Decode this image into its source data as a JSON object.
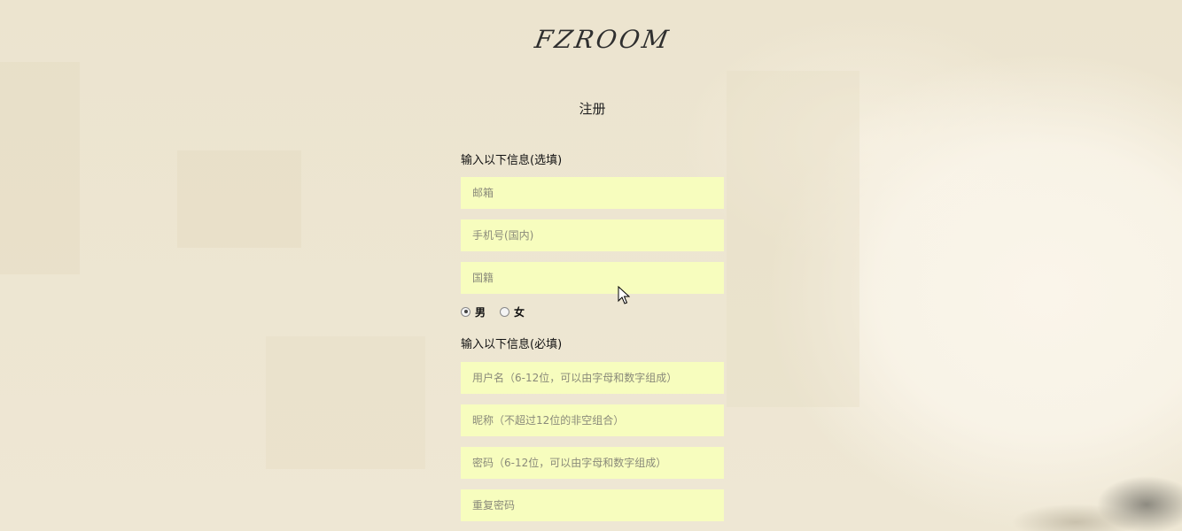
{
  "logo": "FZROOM",
  "title": "注册",
  "optional_section": {
    "label": "输入以下信息(选填)",
    "email_placeholder": "邮箱",
    "phone_placeholder": "手机号(国内)",
    "nationality_placeholder": "国籍",
    "gender": {
      "male_label": "男",
      "female_label": "女",
      "selected": "男"
    }
  },
  "required_section": {
    "label": "输入以下信息(必填)",
    "username_placeholder": "用户名（6-12位，可以由字母和数字组成）",
    "nickname_placeholder": "昵称（不超过12位的非空组合）",
    "password_placeholder": "密码（6-12位，可以由字母和数字组成）",
    "confirm_password_placeholder": "重复密码"
  },
  "colors": {
    "field_bg": "#f7fdbe",
    "page_bg": "#efe8d6",
    "text": "#111111"
  },
  "icons": {
    "cursor": "mouse-pointer-icon"
  }
}
